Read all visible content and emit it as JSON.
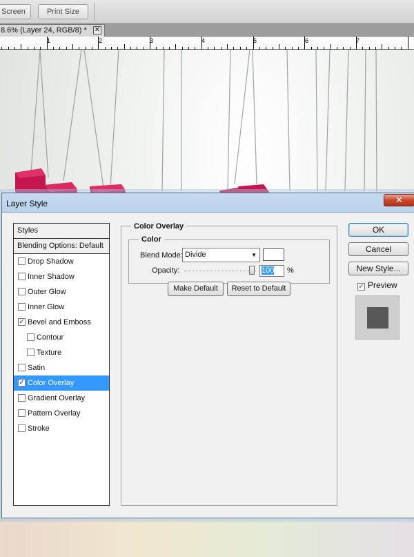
{
  "toolbar": {
    "screen_label": "Screen",
    "print_size_label": "Print Size"
  },
  "document_tab": {
    "title": "8.6% (Layer 24, RGB/8) *",
    "close_glyph": "✕"
  },
  "ruler": {
    "numbers": [
      "1",
      "2",
      "3",
      "4",
      "5",
      "6",
      "7"
    ]
  },
  "dialog": {
    "title": "Layer Style",
    "close_glyph": "✕",
    "styles_header": "Styles",
    "blending_options": "Blending Options: Default",
    "styles": [
      {
        "label": "Drop Shadow",
        "checked": false,
        "selected": false,
        "indent": false
      },
      {
        "label": "Inner Shadow",
        "checked": false,
        "selected": false,
        "indent": false
      },
      {
        "label": "Outer Glow",
        "checked": false,
        "selected": false,
        "indent": false
      },
      {
        "label": "Inner Glow",
        "checked": false,
        "selected": false,
        "indent": false
      },
      {
        "label": "Bevel and Emboss",
        "checked": true,
        "selected": false,
        "indent": false
      },
      {
        "label": "Contour",
        "checked": false,
        "selected": false,
        "indent": true
      },
      {
        "label": "Texture",
        "checked": false,
        "selected": false,
        "indent": true
      },
      {
        "label": "Satin",
        "checked": false,
        "selected": false,
        "indent": false
      },
      {
        "label": "Color Overlay",
        "checked": true,
        "selected": true,
        "indent": false
      },
      {
        "label": "Gradient Overlay",
        "checked": false,
        "selected": false,
        "indent": false
      },
      {
        "label": "Pattern Overlay",
        "checked": false,
        "selected": false,
        "indent": false
      },
      {
        "label": "Stroke",
        "checked": false,
        "selected": false,
        "indent": false
      }
    ],
    "panel_title": "Color Overlay",
    "group_title": "Color",
    "blend_mode_label": "Blend Mode:",
    "blend_mode_value": "Divide",
    "overlay_color": "#ffffff",
    "opacity_label": "Opacity:",
    "opacity_value": "100",
    "opacity_unit": "%",
    "make_default_label": "Make Default",
    "reset_default_label": "Reset to Default",
    "ok_label": "OK",
    "cancel_label": "Cancel",
    "new_style_label": "New Style...",
    "preview_label": "Preview",
    "preview_checked": true
  },
  "colors": {
    "selection": "#3399ff",
    "cube": "#c4164f",
    "preview_swatch": "#585858"
  }
}
